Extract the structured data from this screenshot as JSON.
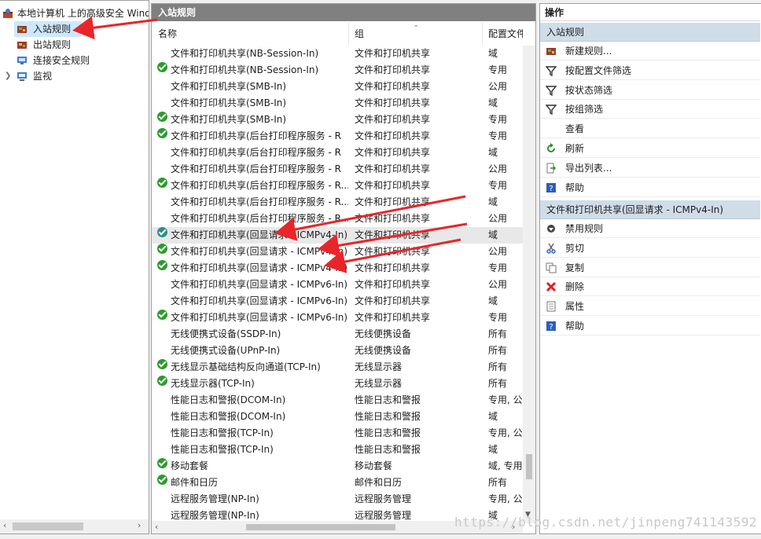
{
  "tree": {
    "root": "本地计算机 上的高级安全 Windows Defender 防火墙",
    "items": [
      {
        "label": "入站规则",
        "selected": true
      },
      {
        "label": "出站规则",
        "selected": false
      },
      {
        "label": "连接安全规则",
        "selected": false
      },
      {
        "label": "监视",
        "selected": false,
        "expandable": true
      }
    ]
  },
  "main": {
    "title": "入站规则",
    "columns": [
      "名称",
      "组",
      "配置文件"
    ],
    "rows": [
      {
        "name": "文件和打印机共享(NB-Session-In)",
        "group": "文件和打印机共享",
        "profile": "域",
        "enabled": false
      },
      {
        "name": "文件和打印机共享(NB-Session-In)",
        "group": "文件和打印机共享",
        "profile": "专用",
        "enabled": true
      },
      {
        "name": "文件和打印机共享(SMB-In)",
        "group": "文件和打印机共享",
        "profile": "公用",
        "enabled": false
      },
      {
        "name": "文件和打印机共享(SMB-In)",
        "group": "文件和打印机共享",
        "profile": "域",
        "enabled": false
      },
      {
        "name": "文件和打印机共享(SMB-In)",
        "group": "文件和打印机共享",
        "profile": "专用",
        "enabled": true
      },
      {
        "name": "文件和打印机共享(后台打印程序服务 - R",
        "group": "文件和打印机共享",
        "profile": "专用",
        "enabled": true
      },
      {
        "name": "文件和打印机共享(后台打印程序服务 - R",
        "group": "文件和打印机共享",
        "profile": "域",
        "enabled": false
      },
      {
        "name": "文件和打印机共享(后台打印程序服务 - R",
        "group": "文件和打印机共享",
        "profile": "公用",
        "enabled": false
      },
      {
        "name": "文件和打印机共享(后台打印程序服务 - R...",
        "group": "文件和打印机共享",
        "profile": "专用",
        "enabled": true
      },
      {
        "name": "文件和打印机共享(后台打印程序服务 - R...",
        "group": "文件和打印机共享",
        "profile": "域",
        "enabled": false
      },
      {
        "name": "文件和打印机共享(后台打印程序服务 - R...",
        "group": "文件和打印机共享",
        "profile": "公用",
        "enabled": false
      },
      {
        "name": "文件和打印机共享(回显请求 - ICMPv4-In)",
        "group": "文件和打印机共享",
        "profile": "域",
        "enabled": true,
        "highlight": true
      },
      {
        "name": "文件和打印机共享(回显请求 - ICMPv4-In)",
        "group": "文件和打印机共享",
        "profile": "公用",
        "enabled": true
      },
      {
        "name": "文件和打印机共享(回显请求 - ICMPv4-In)",
        "group": "文件和打印机共享",
        "profile": "专用",
        "enabled": true
      },
      {
        "name": "文件和打印机共享(回显请求 - ICMPv6-In)",
        "group": "文件和打印机共享",
        "profile": "公用",
        "enabled": false
      },
      {
        "name": "文件和打印机共享(回显请求 - ICMPv6-In)",
        "group": "文件和打印机共享",
        "profile": "域",
        "enabled": false
      },
      {
        "name": "文件和打印机共享(回显请求 - ICMPv6-In)",
        "group": "文件和打印机共享",
        "profile": "专用",
        "enabled": true
      },
      {
        "name": "无线便携式设备(SSDP-In)",
        "group": "无线便携设备",
        "profile": "所有",
        "enabled": false
      },
      {
        "name": "无线便携式设备(UPnP-In)",
        "group": "无线便携设备",
        "profile": "所有",
        "enabled": false
      },
      {
        "name": "无线显示基础结构反向通道(TCP-In)",
        "group": "无线显示器",
        "profile": "所有",
        "enabled": true
      },
      {
        "name": "无线显示器(TCP-In)",
        "group": "无线显示器",
        "profile": "所有",
        "enabled": true
      },
      {
        "name": "性能日志和警报(DCOM-In)",
        "group": "性能日志和警报",
        "profile": "专用, 公",
        "enabled": false
      },
      {
        "name": "性能日志和警报(DCOM-In)",
        "group": "性能日志和警报",
        "profile": "域",
        "enabled": false
      },
      {
        "name": "性能日志和警报(TCP-In)",
        "group": "性能日志和警报",
        "profile": "专用, 公",
        "enabled": false
      },
      {
        "name": "性能日志和警报(TCP-In)",
        "group": "性能日志和警报",
        "profile": "域",
        "enabled": false
      },
      {
        "name": "移动套餐",
        "group": "移动套餐",
        "profile": "域, 专用",
        "enabled": true
      },
      {
        "name": "邮件和日历",
        "group": "邮件和日历",
        "profile": "所有",
        "enabled": true
      },
      {
        "name": "远程服务管理(NP-In)",
        "group": "远程服务管理",
        "profile": "专用, 公",
        "enabled": false
      },
      {
        "name": "远程服务管理(NP-In)",
        "group": "远程服务管理",
        "profile": "域",
        "enabled": false
      }
    ]
  },
  "actions": {
    "title": "操作",
    "section1": "入站规则",
    "items1": [
      {
        "label": "新建规则...",
        "icon": "new-rule-icon"
      },
      {
        "label": "按配置文件筛选",
        "icon": "filter-icon"
      },
      {
        "label": "按状态筛选",
        "icon": "filter-icon"
      },
      {
        "label": "按组筛选",
        "icon": "filter-icon"
      },
      {
        "label": "查看",
        "icon": ""
      },
      {
        "label": "刷新",
        "icon": "refresh-icon"
      },
      {
        "label": "导出列表...",
        "icon": "export-icon"
      },
      {
        "label": "帮助",
        "icon": "help-icon"
      }
    ],
    "section2": "文件和打印机共享(回显请求 - ICMPv4-In)",
    "items2": [
      {
        "label": "禁用规则",
        "icon": "disable-icon"
      },
      {
        "label": "剪切",
        "icon": "cut-icon"
      },
      {
        "label": "复制",
        "icon": "copy-icon"
      },
      {
        "label": "删除",
        "icon": "delete-icon"
      },
      {
        "label": "属性",
        "icon": "properties-icon"
      },
      {
        "label": "帮助",
        "icon": "help-icon"
      }
    ]
  },
  "watermark": "https://blog.csdn.net/jinpeng741143592",
  "colors": {
    "accent": "#e8262a",
    "enabled": "#2d9b2d",
    "section": "#cfdde9"
  }
}
